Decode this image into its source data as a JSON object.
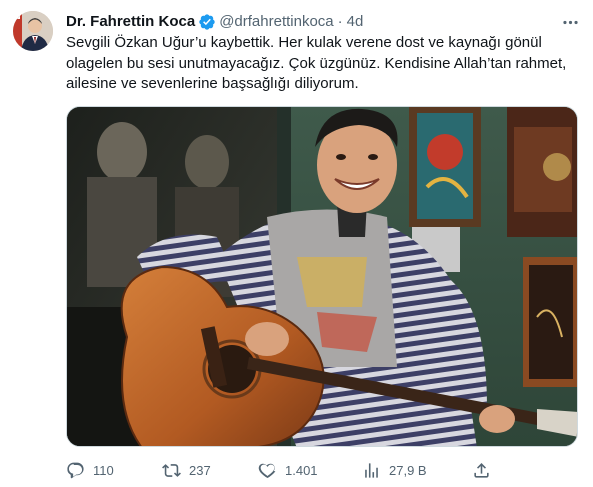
{
  "tweet": {
    "author_name": "Dr. Fahrettin Koca",
    "handle": "@drfahrettinkoca",
    "separator": "·",
    "time": "4d",
    "text_lines": [
      "Sevgili Özkan Uğur’u kaybettik. Her kulak verene dost ve kaynağı gönül",
      "olagelen bu sesi unutmayacağız. Çok üzgünüz. Kendisine Allah’tan rahmet,",
      "ailesine ve sevenlerine başsağlığı diliyorum."
    ],
    "verified_color": "#1d9bf0",
    "media_icon": "photo"
  },
  "actions": {
    "reply": {
      "icon": "reply-icon",
      "count": "110"
    },
    "retweet": {
      "icon": "retweet-icon",
      "count": "237"
    },
    "like": {
      "icon": "heart-icon",
      "count": "1.401"
    },
    "views": {
      "icon": "analytics-icon",
      "count": "27,9 B"
    },
    "share": {
      "icon": "share-icon"
    }
  },
  "colors": {
    "text_primary": "#0f1419",
    "text_secondary": "#536471",
    "accent": "#1d9bf0"
  }
}
